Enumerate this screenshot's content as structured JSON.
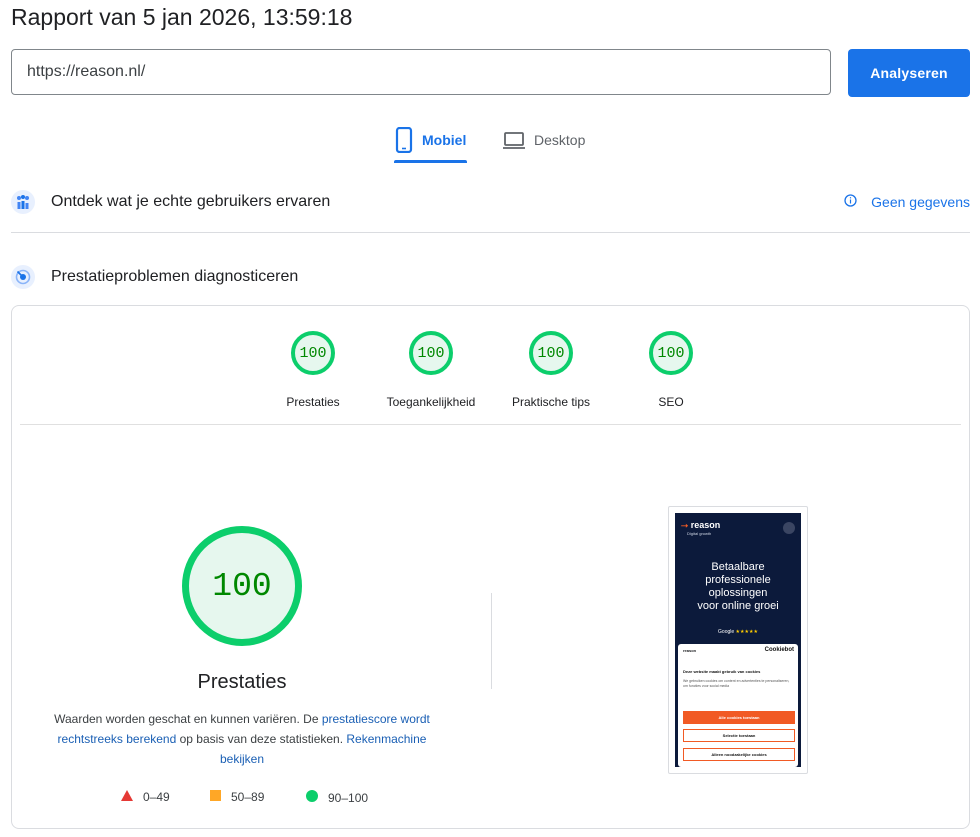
{
  "report": {
    "title": "Rapport van 5 jan 2026, 13:59:18"
  },
  "search": {
    "url_value": "https://reason.nl/",
    "analyze_label": "Analyseren"
  },
  "tabs": [
    {
      "label": "Mobiel",
      "active": true,
      "icon": "smartphone-icon"
    },
    {
      "label": "Desktop",
      "active": false,
      "icon": "laptop-icon"
    }
  ],
  "crux": {
    "title": "Ontdek wat je echte gebruikers ervaren",
    "no_data_label": "Geen gegevens",
    "icon": "users-chart-icon"
  },
  "diagnose": {
    "title": "Prestatieproblemen diagnosticeren",
    "icon": "gauge-icon"
  },
  "categories": [
    {
      "label": "Prestaties",
      "score": "100"
    },
    {
      "label": "Toegankelijkheid",
      "score": "100"
    },
    {
      "label": "Praktische tips",
      "score": "100"
    },
    {
      "label": "SEO",
      "score": "100"
    }
  ],
  "performance": {
    "score": "100",
    "label": "Prestaties",
    "desc_1": "Waarden worden geschat en kunnen variëren. De ",
    "desc_link_1": "prestatiescore wordt rechtstreeks berekend",
    "desc_2": " op basis van deze statistieken. ",
    "desc_link_2": "Rekenmachine bekijken"
  },
  "legend": [
    {
      "range": "0–49",
      "color": "#e53935"
    },
    {
      "range": "50–89",
      "color": "#ffa726"
    },
    {
      "range": "90–100",
      "color": "#0cce6b"
    }
  ],
  "screenshot": {
    "logo": "reason",
    "tagline": "Digital growth",
    "hero_line1": "Betaalbare",
    "hero_line2": "professionele",
    "hero_line3": "oplossingen",
    "hero_line4": "voor online groei",
    "google": "Google",
    "stars": "★★★★★",
    "cookie_brand": "reason",
    "cookiebot": "Cookiebot",
    "cookie_heading": "Deze website maakt gebruik van cookies",
    "cookie_text": "We gebruiken cookies om content en advertenties te personaliseren, om functies voor social media",
    "btn_allow_all": "Alle cookies toestaan",
    "btn_selection": "Selectie toestaan",
    "btn_necessary": "Alleen noodzakelijke cookies"
  },
  "colors": {
    "accent": "#1a73e8",
    "pass": "#0cce6b",
    "pass_text": "#008800"
  }
}
